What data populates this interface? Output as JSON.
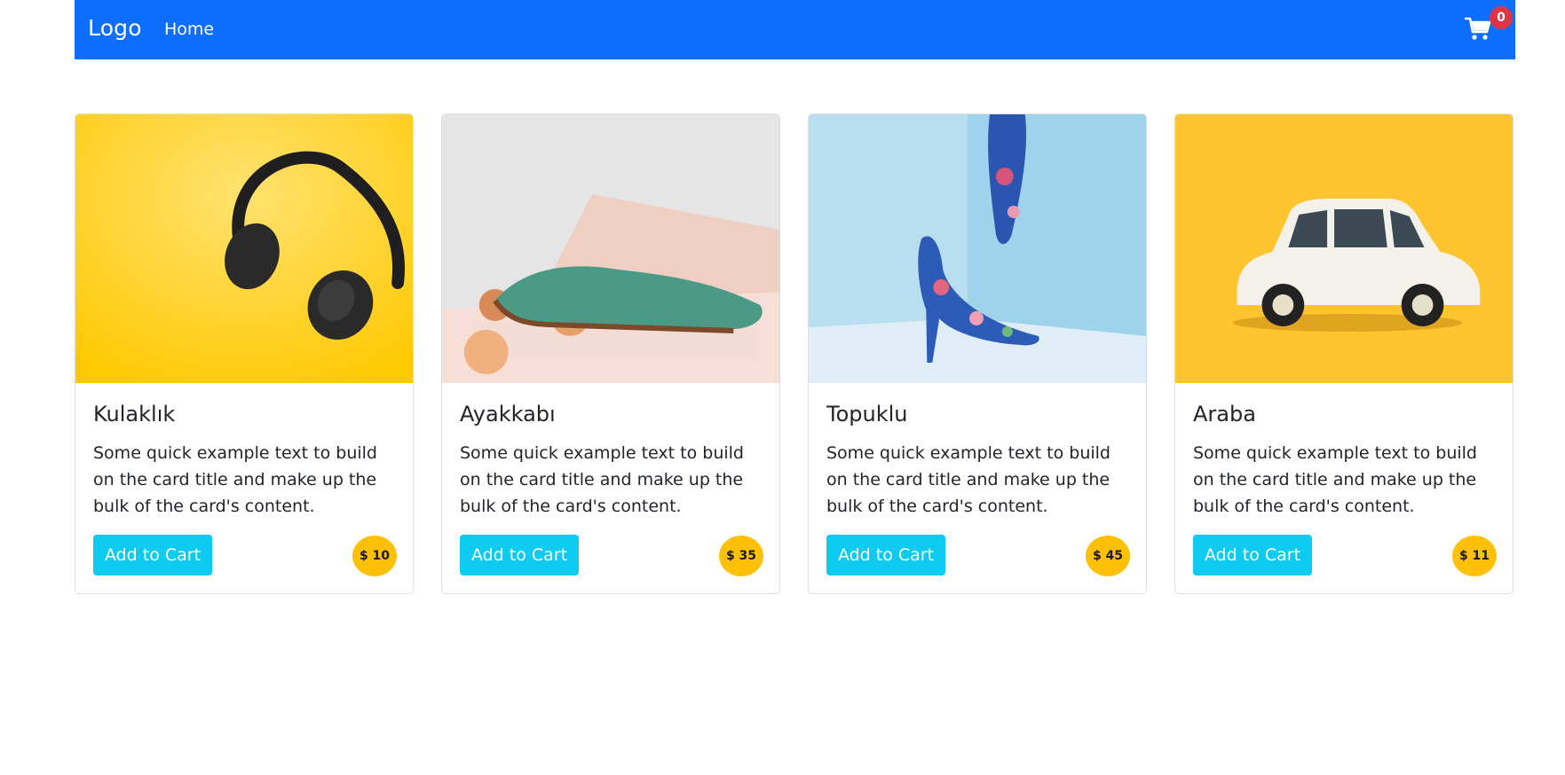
{
  "navbar": {
    "brand": "Logo",
    "home_label": "Home",
    "cart_icon": "cart-icon",
    "cart_count": "0",
    "bg_color": "#0d6efd"
  },
  "products": [
    {
      "title": "Kulaklık",
      "text": "Some quick example text to build on the card title and make up the bulk of the card's content.",
      "button_label": "Add to Cart",
      "price": "$ 10",
      "image": "headphones-image"
    },
    {
      "title": "Ayakkabı",
      "text": "Some quick example text to build on the card title and make up the bulk of the card's content.",
      "button_label": "Add to Cart",
      "price": "$ 35",
      "image": "shoe-image"
    },
    {
      "title": "Topuklu",
      "text": "Some quick example text to build on the card title and make up the bulk of the card's content.",
      "button_label": "Add to Cart",
      "price": "$ 45",
      "image": "high-heel-image"
    },
    {
      "title": "Araba",
      "text": "Some quick example text to build on the card title and make up the bulk of the card's content.",
      "button_label": "Add to Cart",
      "price": "$ 11",
      "image": "toy-car-image"
    }
  ],
  "colors": {
    "button": "#0dcaf0",
    "price_badge": "#ffc107",
    "cart_badge": "#dc3545"
  }
}
